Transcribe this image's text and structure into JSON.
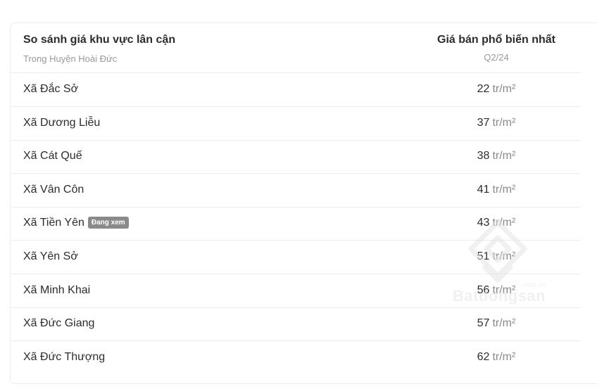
{
  "header": {
    "title": "So sánh giá khu vực lân cận",
    "subtitle": "Trong Huyện Hoài Đức",
    "price_col_title": "Giá bán phổ biến nhất",
    "price_col_period": "Q2/24"
  },
  "rows": [
    {
      "name": "Xã Đắc Sở",
      "price": "22",
      "unit": "tr/m²",
      "badge": ""
    },
    {
      "name": "Xã Dương Liễu",
      "price": "37",
      "unit": "tr/m²",
      "badge": ""
    },
    {
      "name": "Xã Cát Quế",
      "price": "38",
      "unit": "tr/m²",
      "badge": ""
    },
    {
      "name": "Xã Vân Côn",
      "price": "41",
      "unit": "tr/m²",
      "badge": ""
    },
    {
      "name": "Xã Tiền Yên",
      "price": "43",
      "unit": "tr/m²",
      "badge": "Đang xem"
    },
    {
      "name": "Xã Yên Sở",
      "price": "51",
      "unit": "tr/m²",
      "badge": ""
    },
    {
      "name": "Xã Minh Khai",
      "price": "56",
      "unit": "tr/m²",
      "badge": ""
    },
    {
      "name": "Xã Đức Giang",
      "price": "57",
      "unit": "tr/m²",
      "badge": ""
    },
    {
      "name": "Xã Đức Thượng",
      "price": "62",
      "unit": "tr/m²",
      "badge": ""
    }
  ],
  "watermark": {
    "brand": "Batdongsan",
    "domain": ".com.vn",
    "icon": "house-logo-icon"
  }
}
